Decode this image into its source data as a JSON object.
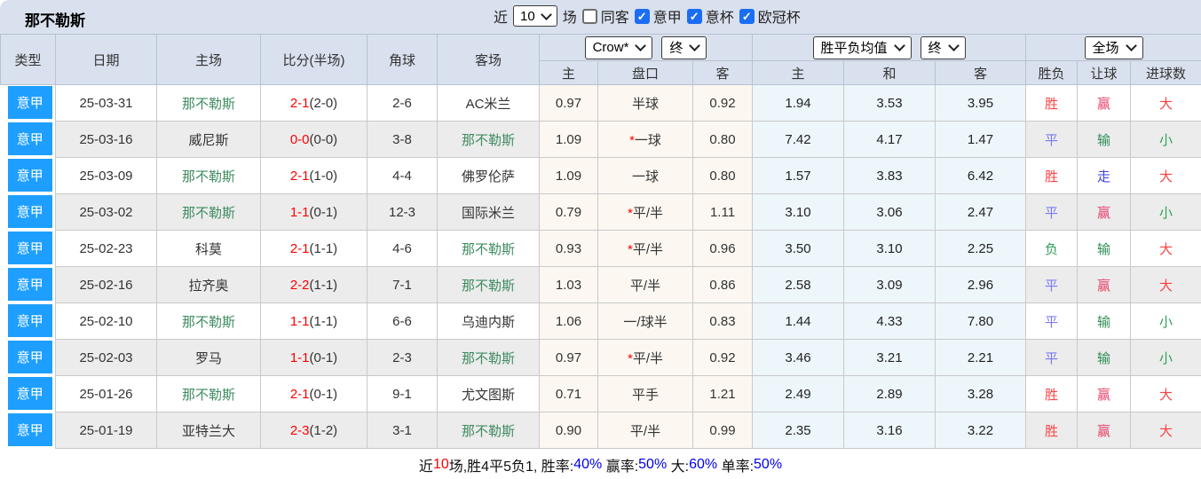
{
  "header": {
    "team_title": "那不勒斯",
    "recent_label": "近",
    "recent_count": "10",
    "matches_label": "场",
    "filters": [
      {
        "label": "同客",
        "checked": false
      },
      {
        "label": "意甲",
        "checked": true
      },
      {
        "label": "意杯",
        "checked": true
      },
      {
        "label": "欧冠杯",
        "checked": true
      }
    ]
  },
  "controls": {
    "odds_company": "Crow*",
    "odds_company_time": "终",
    "avg_type": "胜平负均值",
    "avg_time": "终",
    "scope": "全场"
  },
  "icons": {
    "check": "✓"
  },
  "table": {
    "main_headers": [
      "类型",
      "日期",
      "主场",
      "比分(半场)",
      "角球",
      "客场"
    ],
    "sub_headers": [
      "主",
      "盘口",
      "客",
      "主",
      "和",
      "客",
      "胜负",
      "让球",
      "进球数"
    ],
    "focus_team": "那不勒斯",
    "rows": [
      {
        "league": "意甲",
        "date": "25-03-31",
        "home": "那不勒斯",
        "score": "2-1",
        "half": "(2-0)",
        "corners": "2-6",
        "away": "AC米兰",
        "odds_home": "0.97",
        "handicap": "半球",
        "handicap_star": false,
        "odds_away": "0.92",
        "avg_home": "1.94",
        "avg_draw": "3.53",
        "avg_away": "3.95",
        "result": "胜",
        "handicap_result": "赢",
        "goals": "大"
      },
      {
        "league": "意甲",
        "date": "25-03-16",
        "home": "威尼斯",
        "score": "0-0",
        "half": "(0-0)",
        "corners": "3-8",
        "away": "那不勒斯",
        "odds_home": "1.09",
        "handicap": "一球",
        "handicap_star": true,
        "odds_away": "0.80",
        "avg_home": "7.42",
        "avg_draw": "4.17",
        "avg_away": "1.47",
        "result": "平",
        "handicap_result": "输",
        "goals": "小"
      },
      {
        "league": "意甲",
        "date": "25-03-09",
        "home": "那不勒斯",
        "score": "2-1",
        "half": "(1-0)",
        "corners": "4-4",
        "away": "佛罗伦萨",
        "odds_home": "1.09",
        "handicap": "一球",
        "handicap_star": false,
        "odds_away": "0.80",
        "avg_home": "1.57",
        "avg_draw": "3.83",
        "avg_away": "6.42",
        "result": "胜",
        "handicap_result": "走",
        "goals": "大"
      },
      {
        "league": "意甲",
        "date": "25-03-02",
        "home": "那不勒斯",
        "score": "1-1",
        "half": "(0-1)",
        "corners": "12-3",
        "away": "国际米兰",
        "odds_home": "0.79",
        "handicap": "平/半",
        "handicap_star": true,
        "odds_away": "1.11",
        "avg_home": "3.10",
        "avg_draw": "3.06",
        "avg_away": "2.47",
        "result": "平",
        "handicap_result": "赢",
        "goals": "小"
      },
      {
        "league": "意甲",
        "date": "25-02-23",
        "home": "科莫",
        "score": "2-1",
        "half": "(1-1)",
        "corners": "4-6",
        "away": "那不勒斯",
        "odds_home": "0.93",
        "handicap": "平/半",
        "handicap_star": true,
        "odds_away": "0.96",
        "avg_home": "3.50",
        "avg_draw": "3.10",
        "avg_away": "2.25",
        "result": "负",
        "handicap_result": "输",
        "goals": "大"
      },
      {
        "league": "意甲",
        "date": "25-02-16",
        "home": "拉齐奥",
        "score": "2-2",
        "half": "(1-1)",
        "corners": "7-1",
        "away": "那不勒斯",
        "odds_home": "1.03",
        "handicap": "平/半",
        "handicap_star": false,
        "odds_away": "0.86",
        "avg_home": "2.58",
        "avg_draw": "3.09",
        "avg_away": "2.96",
        "result": "平",
        "handicap_result": "赢",
        "goals": "大"
      },
      {
        "league": "意甲",
        "date": "25-02-10",
        "home": "那不勒斯",
        "score": "1-1",
        "half": "(1-1)",
        "corners": "6-6",
        "away": "乌迪内斯",
        "odds_home": "1.06",
        "handicap": "一/球半",
        "handicap_star": false,
        "odds_away": "0.83",
        "avg_home": "1.44",
        "avg_draw": "4.33",
        "avg_away": "7.80",
        "result": "平",
        "handicap_result": "输",
        "goals": "小"
      },
      {
        "league": "意甲",
        "date": "25-02-03",
        "home": "罗马",
        "score": "1-1",
        "half": "(0-1)",
        "corners": "2-3",
        "away": "那不勒斯",
        "odds_home": "0.97",
        "handicap": "平/半",
        "handicap_star": true,
        "odds_away": "0.92",
        "avg_home": "3.46",
        "avg_draw": "3.21",
        "avg_away": "2.21",
        "result": "平",
        "handicap_result": "输",
        "goals": "小"
      },
      {
        "league": "意甲",
        "date": "25-01-26",
        "home": "那不勒斯",
        "score": "2-1",
        "half": "(0-1)",
        "corners": "9-1",
        "away": "尤文图斯",
        "odds_home": "0.71",
        "handicap": "平手",
        "handicap_star": false,
        "odds_away": "1.21",
        "avg_home": "2.49",
        "avg_draw": "2.89",
        "avg_away": "3.28",
        "result": "胜",
        "handicap_result": "赢",
        "goals": "大"
      },
      {
        "league": "意甲",
        "date": "25-01-19",
        "home": "亚特兰大",
        "score": "2-3",
        "half": "(1-2)",
        "corners": "3-1",
        "away": "那不勒斯",
        "odds_home": "0.90",
        "handicap": "平/半",
        "handicap_star": false,
        "odds_away": "0.99",
        "avg_home": "2.35",
        "avg_draw": "3.16",
        "avg_away": "3.22",
        "result": "胜",
        "handicap_result": "赢",
        "goals": "大"
      }
    ]
  },
  "colors": {
    "league_bg": "#1e9fff",
    "focus_team": "#3d8b5f",
    "score": "#ff0000",
    "star": "#ff0000",
    "胜": "#ff4242",
    "平": "#7878f2",
    "负": "#2e9e5b",
    "赢": "#e8436b",
    "输": "#2e8b57",
    "走": "#4242f0",
    "大": "#ff4242",
    "小": "#2e9e5b"
  },
  "footer": {
    "segments": [
      {
        "text": "近",
        "type": "plain"
      },
      {
        "text": "10",
        "type": "red"
      },
      {
        "text": "场,胜4平5负1, 胜率:",
        "type": "plain"
      },
      {
        "text": "40%",
        "type": "blue"
      },
      {
        "text": " 赢率:",
        "type": "plain"
      },
      {
        "text": "50%",
        "type": "blue"
      },
      {
        "text": " 大:",
        "type": "plain"
      },
      {
        "text": "60%",
        "type": "blue"
      },
      {
        "text": " 单率:",
        "type": "plain"
      },
      {
        "text": "50%",
        "type": "blue"
      }
    ]
  }
}
